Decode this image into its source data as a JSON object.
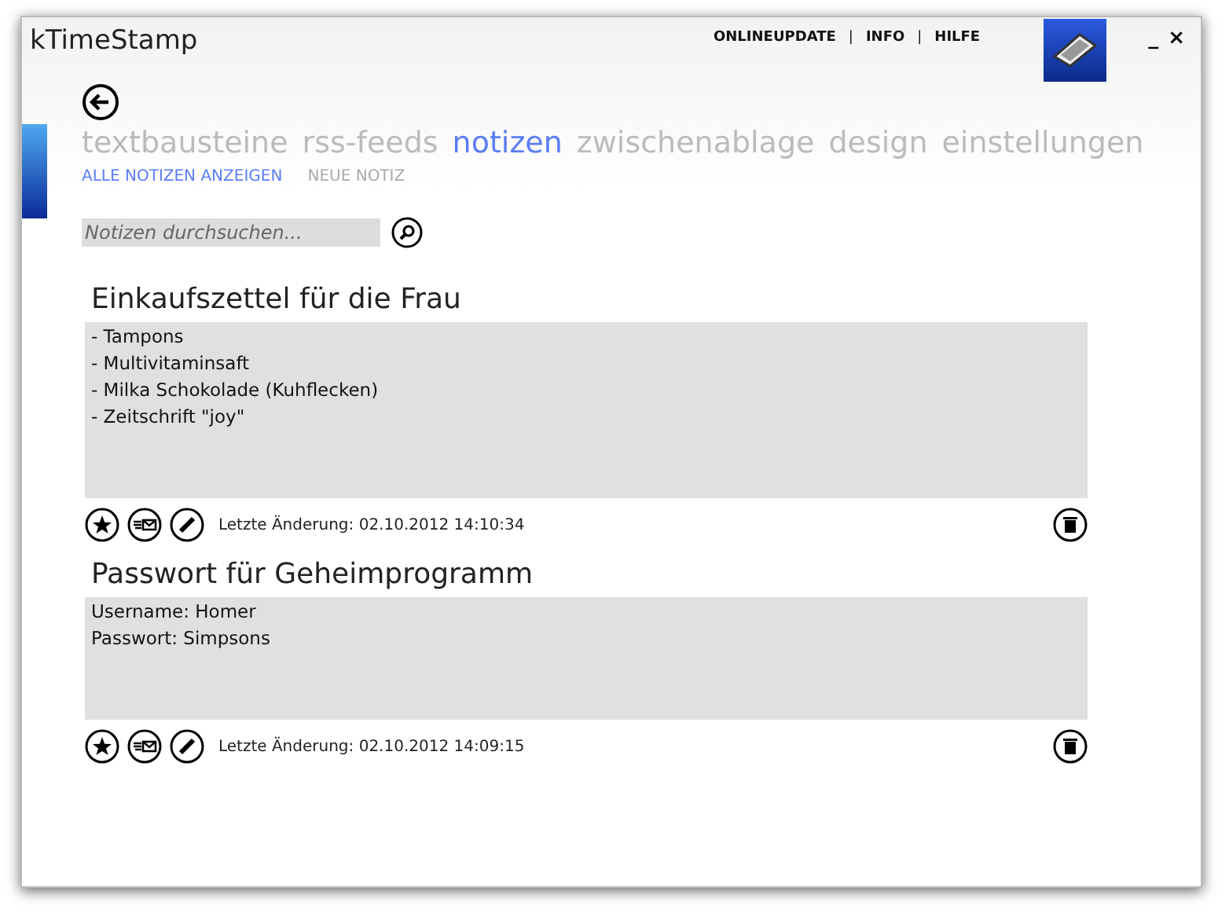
{
  "window": {
    "title": "kTimeStamp"
  },
  "top_links": [
    "ONLINEUPDATE",
    "INFO",
    "HILFE"
  ],
  "link_separators": [
    "|",
    "|"
  ],
  "window_controls": [
    "_",
    "×"
  ],
  "tabs": [
    {
      "label": "textbausteine",
      "selected": false
    },
    {
      "label": "rss-feeds",
      "selected": false
    },
    {
      "label": "notizen",
      "selected": true
    },
    {
      "label": "zwischenablage",
      "selected": false
    },
    {
      "label": "design",
      "selected": false
    },
    {
      "label": "einstellungen",
      "selected": false
    }
  ],
  "sub_tabs": [
    {
      "label": "ALLE NOTIZEN ANZEIGEN",
      "selected": true
    },
    {
      "label": "NEUE NOTIZ",
      "selected": false
    }
  ],
  "search": {
    "placeholder": "Notizen durchsuchen..."
  },
  "notes": [
    {
      "title": "Einkaufszettel für die Frau",
      "lines": [
        "- Tampons",
        "- Multivitaminsaft",
        "- Milka Schokolade (Kuhflecken)",
        "- Zeitschrift \"joy\""
      ],
      "modified": "Letzte Änderung: 02.10.2012 14:10:34"
    },
    {
      "title": "Passwort für Geheimprogramm",
      "lines": [
        "Username: Homer",
        "Passwort: Simpsons"
      ],
      "modified": "Letzte Änderung: 02.10.2012 14:09:15"
    }
  ]
}
